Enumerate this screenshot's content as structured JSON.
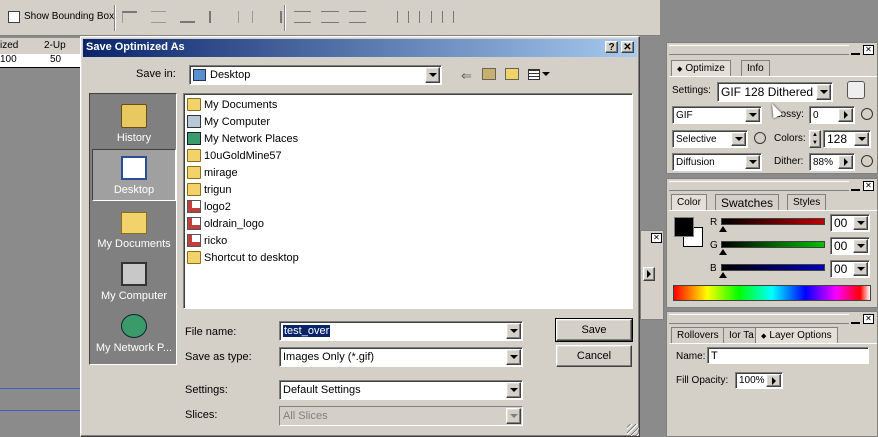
{
  "toolbar": {
    "show_bounding_box": "Show Bounding Box"
  },
  "canvas": {
    "tabs": [
      "ized",
      "2-Up"
    ],
    "ruler": [
      "100",
      "50"
    ]
  },
  "dialog": {
    "title": "Save Optimized As",
    "help_glyph": "?",
    "close_glyph": "✕",
    "save_in_label": "Save in:",
    "save_in_value": "Desktop",
    "places": [
      "History",
      "Desktop",
      "My Documents",
      "My Computer",
      "My Network P..."
    ],
    "files": [
      {
        "name": "My Documents",
        "icon": "my-documents-icon"
      },
      {
        "name": "My Computer",
        "icon": "my-computer-icon"
      },
      {
        "name": "My Network Places",
        "icon": "network-places-icon"
      },
      {
        "name": "10uGoldMine57",
        "icon": "folder-icon"
      },
      {
        "name": "mirage",
        "icon": "folder-icon"
      },
      {
        "name": "trigun",
        "icon": "folder-icon"
      },
      {
        "name": "logo2",
        "icon": "image-file-icon"
      },
      {
        "name": "oldrain_logo",
        "icon": "image-file-icon"
      },
      {
        "name": "ricko",
        "icon": "image-file-icon"
      },
      {
        "name": "Shortcut to desktop",
        "icon": "shortcut-icon"
      }
    ],
    "file_name_label": "File name:",
    "file_name_value": "test_over",
    "save_as_type_label": "Save as type:",
    "save_as_type_value": "Images Only (*.gif)",
    "settings_label": "Settings:",
    "settings_value": "Default Settings",
    "slices_label": "Slices:",
    "slices_value": "All Slices",
    "save_button": "Save",
    "cancel_button": "Cancel"
  },
  "optimize_panel": {
    "tabs": [
      "Optimize",
      "Info"
    ],
    "settings_label": "Settings:",
    "settings_value": "GIF 128 Dithered",
    "format_value": "GIF",
    "lossy_label": "Lossy:",
    "lossy_value": "0",
    "reduction_value": "Selective",
    "colors_label": "Colors:",
    "colors_value": "128",
    "dither_algorithm": "Diffusion",
    "dither_label": "Dither:",
    "dither_value": "88%"
  },
  "color_panel": {
    "tabs": [
      "Color",
      "Swatches",
      "Styles"
    ],
    "channels": [
      {
        "label": "R",
        "value": "00",
        "color": "#c00000"
      },
      {
        "label": "G",
        "value": "00",
        "color": "#00c000"
      },
      {
        "label": "B",
        "value": "00",
        "color": "#0000c0"
      }
    ]
  },
  "layer_panel": {
    "tabs": [
      "Rollovers",
      "Ior Ta",
      "Layer Options"
    ],
    "name_label": "Name:",
    "name_value": "T",
    "fill_opacity_label": "Fill Opacity:",
    "fill_opacity_value": "100%"
  },
  "colors": {
    "titlebar_start": "#0a246a",
    "titlebar_end": "#a6caf0",
    "places_bg": "#808080",
    "selection": "#0a246a"
  }
}
